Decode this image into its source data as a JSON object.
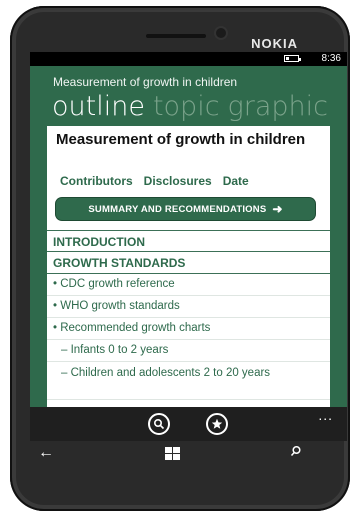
{
  "device": {
    "brand": "NOKIA"
  },
  "status": {
    "time": "8:36",
    "battery_level": 0.3
  },
  "app": {
    "title": "Measurement of growth in children",
    "pivots": [
      "outline",
      "topic",
      "graphic"
    ]
  },
  "content": {
    "page_title": "Measurement of growth in children",
    "links": [
      "Contributors",
      "Disclosures",
      "Date"
    ],
    "summary_button": "SUMMARY AND RECOMMENDATIONS",
    "sections": [
      {
        "label": "INTRODUCTION"
      },
      {
        "label": "GROWTH STANDARDS"
      }
    ],
    "items": [
      "• CDC growth reference",
      "• WHO growth standards",
      "• Recommended growth charts",
      "– Infants 0 to 2 years",
      "– Children and adolescents 2 to 20 years"
    ]
  },
  "appbar": {
    "buttons": [
      "search-icon",
      "favorite-icon"
    ],
    "more": "..."
  },
  "nav": {
    "back": "←",
    "search": "⚲"
  }
}
